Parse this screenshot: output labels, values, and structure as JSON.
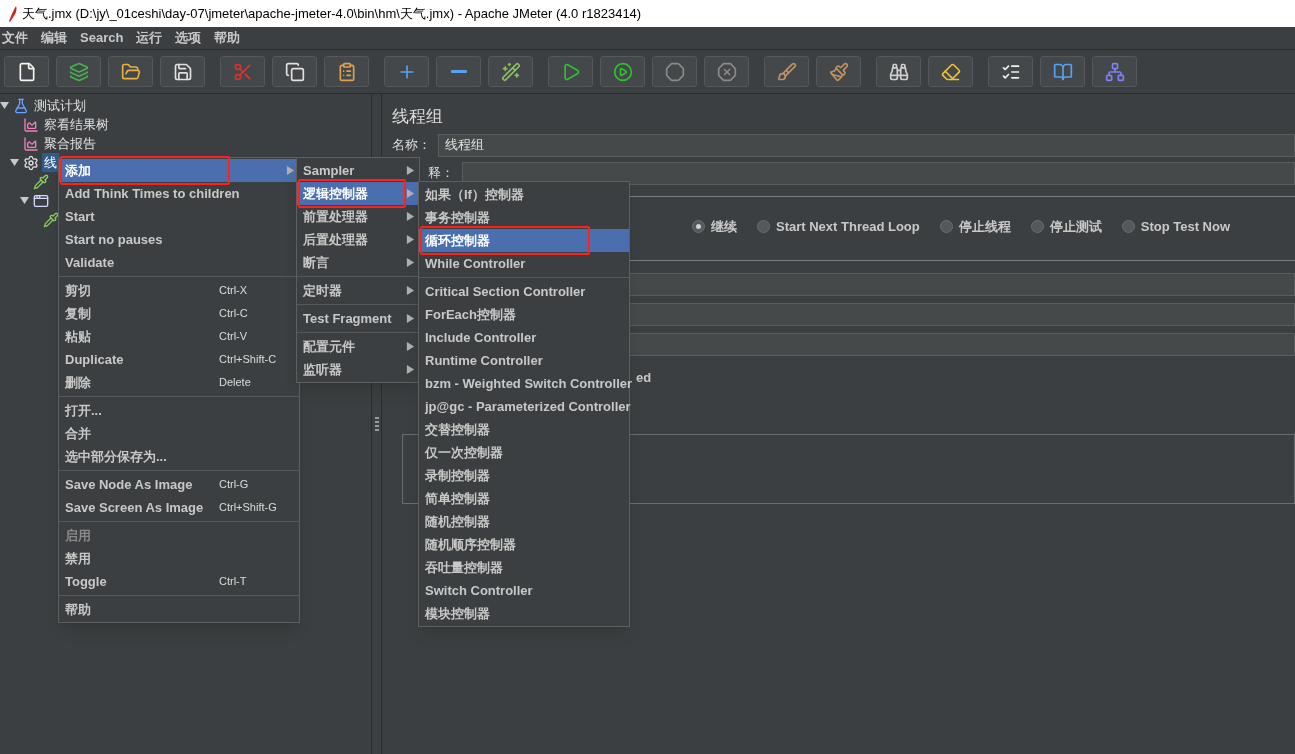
{
  "window": {
    "title": "天气.jmx (D:\\jy\\_01ceshi\\day-07\\jmeter\\apache-jmeter-4.0\\bin\\hm\\天气.jmx) - Apache JMeter (4.0 r1823414)"
  },
  "menu_bar": [
    {
      "label": "文件"
    },
    {
      "label": "编辑"
    },
    {
      "label": "Search"
    },
    {
      "label": "运行"
    },
    {
      "label": "选项"
    },
    {
      "label": "帮助"
    }
  ],
  "toolbar_groups": [
    [
      {
        "kind": "new",
        "disabled": false
      },
      {
        "kind": "templates",
        "disabled": false
      },
      {
        "kind": "open",
        "disabled": false
      },
      {
        "kind": "save",
        "disabled": false
      }
    ],
    [
      {
        "kind": "cut",
        "disabled": false
      },
      {
        "kind": "copy",
        "disabled": false
      },
      {
        "kind": "paste",
        "disabled": false
      }
    ],
    [
      {
        "kind": "expand",
        "disabled": false
      },
      {
        "kind": "collapse",
        "disabled": false
      },
      {
        "kind": "toggle",
        "disabled": false
      }
    ],
    [
      {
        "kind": "start",
        "disabled": false
      },
      {
        "kind": "start-no-pause",
        "disabled": false
      },
      {
        "kind": "stop",
        "disabled": true
      },
      {
        "kind": "shutdown",
        "disabled": true
      }
    ],
    [
      {
        "kind": "clear",
        "disabled": false
      },
      {
        "kind": "clear-all",
        "disabled": false
      }
    ],
    [
      {
        "kind": "search",
        "disabled": false
      },
      {
        "kind": "reset-search",
        "disabled": false
      }
    ],
    [
      {
        "kind": "functions",
        "disabled": false
      },
      {
        "kind": "help",
        "disabled": false
      },
      {
        "kind": "remote",
        "disabled": false
      }
    ]
  ],
  "tree": [
    {
      "kind": "plan",
      "label": "测试计划",
      "expanded": true,
      "selected": false,
      "children": [
        {
          "kind": "listener",
          "label": "察看结果树",
          "selected": false
        },
        {
          "kind": "listener",
          "label": "聚合报告",
          "selected": false
        },
        {
          "kind": "threadgroup",
          "label": "线",
          "expanded": true,
          "selected": true,
          "children": [
            {
              "kind": "sampler",
              "selected": false
            },
            {
              "kind": "controller",
              "expanded": true,
              "selected": false,
              "children": [
                {
                  "kind": "sampler",
                  "selected": false
                }
              ]
            }
          ]
        }
      ]
    }
  ],
  "panel": {
    "title": "线程组",
    "name_label": "名称：",
    "name_value": "线程组",
    "comment_label": "释：",
    "error_actions": [
      {
        "label": "继续",
        "selected": true
      },
      {
        "label": "Start Next Thread Loop",
        "selected": false
      },
      {
        "label": "停止线程",
        "selected": false
      },
      {
        "label": "停止测试",
        "selected": false
      },
      {
        "label": "Stop Test Now",
        "selected": false
      }
    ],
    "fragment": "ed"
  },
  "context_menu": [
    {
      "kind": "item",
      "label": "添加",
      "submenu": true,
      "selected": true,
      "highlighted": true,
      "disabled": false
    },
    {
      "kind": "item",
      "label": "Add Think Times to children",
      "selected": false,
      "highlighted": false,
      "disabled": false
    },
    {
      "kind": "item",
      "label": "Start",
      "selected": false,
      "highlighted": false,
      "disabled": false
    },
    {
      "kind": "item",
      "label": "Start no pauses",
      "selected": false,
      "highlighted": false,
      "disabled": false
    },
    {
      "kind": "item",
      "label": "Validate",
      "selected": false,
      "highlighted": false,
      "disabled": false
    },
    {
      "kind": "separator"
    },
    {
      "kind": "item",
      "label": "剪切",
      "shortcut": "Ctrl-X",
      "selected": false,
      "highlighted": false,
      "disabled": false
    },
    {
      "kind": "item",
      "label": "复制",
      "shortcut": "Ctrl-C",
      "selected": false,
      "highlighted": false,
      "disabled": false
    },
    {
      "kind": "item",
      "label": "粘贴",
      "shortcut": "Ctrl-V",
      "selected": false,
      "highlighted": false,
      "disabled": false
    },
    {
      "kind": "item",
      "label": "Duplicate",
      "shortcut": "Ctrl+Shift-C",
      "selected": false,
      "highlighted": false,
      "disabled": false
    },
    {
      "kind": "item",
      "label": "删除",
      "shortcut": "Delete",
      "selected": false,
      "highlighted": false,
      "disabled": false
    },
    {
      "kind": "separator"
    },
    {
      "kind": "item",
      "label": "打开...",
      "selected": false,
      "highlighted": false,
      "disabled": false
    },
    {
      "kind": "item",
      "label": "合并",
      "selected": false,
      "highlighted": false,
      "disabled": false
    },
    {
      "kind": "item",
      "label": "选中部分保存为...",
      "selected": false,
      "highlighted": false,
      "disabled": false
    },
    {
      "kind": "separator"
    },
    {
      "kind": "item",
      "label": "Save Node As Image",
      "shortcut": "Ctrl-G",
      "selected": false,
      "highlighted": false,
      "disabled": false
    },
    {
      "kind": "item",
      "label": "Save Screen As Image",
      "shortcut": "Ctrl+Shift-G",
      "selected": false,
      "highlighted": false,
      "disabled": false
    },
    {
      "kind": "separator"
    },
    {
      "kind": "item",
      "label": "启用",
      "selected": false,
      "highlighted": false,
      "disabled": true
    },
    {
      "kind": "item",
      "label": "禁用",
      "selected": false,
      "highlighted": false,
      "disabled": false
    },
    {
      "kind": "item",
      "label": "Toggle",
      "shortcut": "Ctrl-T",
      "selected": false,
      "highlighted": false,
      "disabled": false
    },
    {
      "kind": "separator"
    },
    {
      "kind": "item",
      "label": "帮助",
      "selected": false,
      "highlighted": false,
      "disabled": false
    }
  ],
  "add_submenu": [
    {
      "kind": "item",
      "label": "Sampler",
      "submenu": true,
      "selected": false,
      "highlighted": false,
      "disabled": false
    },
    {
      "kind": "item",
      "label": "逻辑控制器",
      "submenu": true,
      "selected": true,
      "highlighted": true,
      "disabled": false
    },
    {
      "kind": "item",
      "label": "前置处理器",
      "submenu": true,
      "selected": false,
      "highlighted": false,
      "disabled": false
    },
    {
      "kind": "item",
      "label": "后置处理器",
      "submenu": true,
      "selected": false,
      "highlighted": false,
      "disabled": false
    },
    {
      "kind": "item",
      "label": "断言",
      "submenu": true,
      "selected": false,
      "highlighted": false,
      "disabled": false
    },
    {
      "kind": "separator"
    },
    {
      "kind": "item",
      "label": "定时器",
      "submenu": true,
      "selected": false,
      "highlighted": false,
      "disabled": false
    },
    {
      "kind": "separator"
    },
    {
      "kind": "item",
      "label": "Test Fragment",
      "submenu": true,
      "selected": false,
      "highlighted": false,
      "disabled": false
    },
    {
      "kind": "separator"
    },
    {
      "kind": "item",
      "label": "配置元件",
      "submenu": true,
      "selected": false,
      "highlighted": false,
      "disabled": false
    },
    {
      "kind": "item",
      "label": "监听器",
      "submenu": true,
      "selected": false,
      "highlighted": false,
      "disabled": false
    }
  ],
  "controller_submenu": [
    {
      "kind": "item",
      "label": "如果（If）控制器",
      "selected": false,
      "highlighted": false,
      "disabled": false
    },
    {
      "kind": "item",
      "label": "事务控制器",
      "selected": false,
      "highlighted": false,
      "disabled": false
    },
    {
      "kind": "item",
      "label": "循环控制器",
      "selected": true,
      "highlighted": true,
      "disabled": false
    },
    {
      "kind": "item",
      "label": "While Controller",
      "selected": false,
      "highlighted": false,
      "disabled": false
    },
    {
      "kind": "separator"
    },
    {
      "kind": "item",
      "label": "Critical Section Controller",
      "selected": false,
      "highlighted": false,
      "disabled": false
    },
    {
      "kind": "item",
      "label": "ForEach控制器",
      "selected": false,
      "highlighted": false,
      "disabled": false
    },
    {
      "kind": "item",
      "label": "Include Controller",
      "selected": false,
      "highlighted": false,
      "disabled": false
    },
    {
      "kind": "item",
      "label": "Runtime Controller",
      "selected": false,
      "highlighted": false,
      "disabled": false
    },
    {
      "kind": "item",
      "label": "bzm - Weighted Switch Controller",
      "selected": false,
      "highlighted": false,
      "disabled": false
    },
    {
      "kind": "item",
      "label": "jp@gc - Parameterized Controller",
      "selected": false,
      "highlighted": false,
      "disabled": false
    },
    {
      "kind": "item",
      "label": "交替控制器",
      "selected": false,
      "highlighted": false,
      "disabled": false
    },
    {
      "kind": "item",
      "label": "仅一次控制器",
      "selected": false,
      "highlighted": false,
      "disabled": false
    },
    {
      "kind": "item",
      "label": "录制控制器",
      "selected": false,
      "highlighted": false,
      "disabled": false
    },
    {
      "kind": "item",
      "label": "简单控制器",
      "selected": false,
      "highlighted": false,
      "disabled": false
    },
    {
      "kind": "item",
      "label": "随机控制器",
      "selected": false,
      "highlighted": false,
      "disabled": false
    },
    {
      "kind": "item",
      "label": "随机顺序控制器",
      "selected": false,
      "highlighted": false,
      "disabled": false
    },
    {
      "kind": "item",
      "label": "吞吐量控制器",
      "selected": false,
      "highlighted": false,
      "disabled": false
    },
    {
      "kind": "item",
      "label": "Switch Controller",
      "selected": false,
      "highlighted": false,
      "disabled": false
    },
    {
      "kind": "item",
      "label": "模块控制器",
      "selected": false,
      "highlighted": false,
      "disabled": false
    }
  ]
}
